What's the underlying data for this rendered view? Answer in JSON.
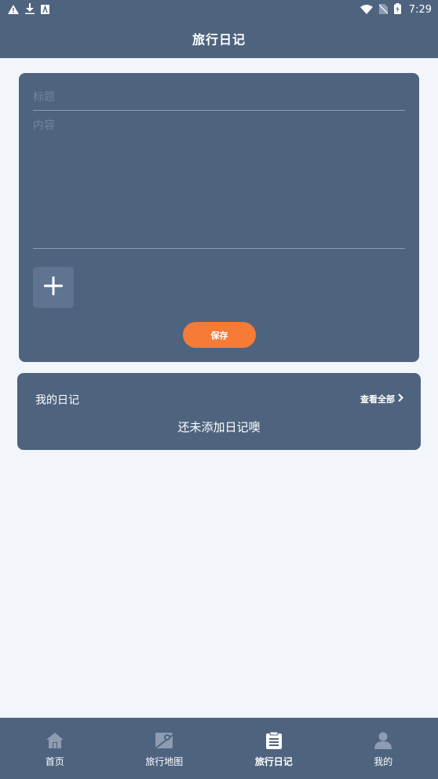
{
  "status": {
    "time": "7:29"
  },
  "header": {
    "title": "旅行日记"
  },
  "editor": {
    "title_placeholder": "标题",
    "content_placeholder": "内容",
    "save_label": "保存",
    "accent": "#f57b36"
  },
  "diary": {
    "title": "我的日记",
    "view_all": "查看全部",
    "empty": "还未添加日记噢"
  },
  "tabs": [
    {
      "label": "首页",
      "icon": "home-icon",
      "active": false
    },
    {
      "label": "旅行地图",
      "icon": "map-icon",
      "active": false
    },
    {
      "label": "旅行日记",
      "icon": "clipboard-icon",
      "active": true
    },
    {
      "label": "我的",
      "icon": "user-icon",
      "active": false
    }
  ],
  "colors": {
    "primary": "#4e637e",
    "background": "#f2f5f9"
  }
}
